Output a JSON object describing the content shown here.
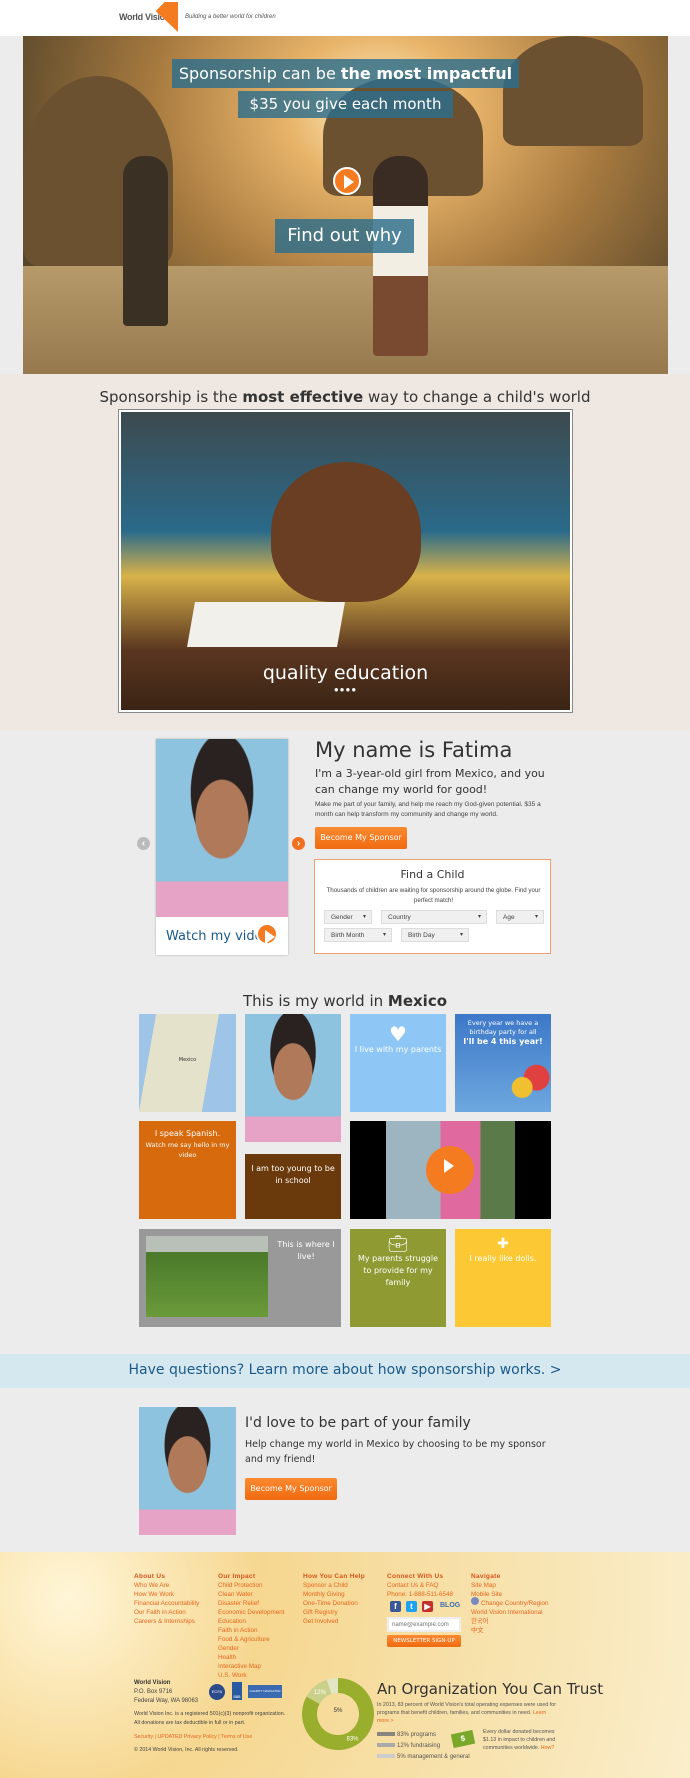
{
  "header": {
    "logo_text": "World Vision",
    "tagline": "Building a better world for children"
  },
  "hero": {
    "headline_prefix": "Sponsorship can be ",
    "headline_bold": "the most impactful",
    "subline": "$35 you give each month",
    "cta": "Find out why"
  },
  "impact": {
    "title_prefix": "Sponsorship is the ",
    "title_bold": "most effective",
    "title_suffix": " way to change a child's world",
    "caption": "quality education",
    "dots": "●●●●"
  },
  "child": {
    "name_heading": "My name is Fatima",
    "intro": "I'm a 3-year-old girl from Mexico, and you can change my world for good!",
    "details": "Make me part of your family, and help me reach my God-given potential. $35 a month can help transform my community and change my world.",
    "sponsor_button": "Become My Sponsor",
    "watch_video": "Watch my video!",
    "prev_arrow": "‹",
    "next_arrow": "›"
  },
  "find_child": {
    "title": "Find a Child",
    "description": "Thousands of children are waiting for sponsorship around the globe. Find your perfect match!",
    "filters": {
      "gender": "Gender",
      "country": "Country",
      "age": "Age",
      "birth_month": "Birth Month",
      "birth_day": "Birth Day"
    }
  },
  "world": {
    "title_prefix": "This is my world in ",
    "title_bold": "Mexico",
    "map_label": "Mexico",
    "parents": "I live with my parents",
    "birthday_line1": "Every year we have a",
    "birthday_line2": "birthday party for all",
    "birthday_line3": "I'll be 4 this year!",
    "spanish_title": "I speak Spanish.",
    "spanish_sub": "Watch me say hello in my video",
    "school": "I am too young to be in school",
    "where_live": "This is where I live!",
    "struggle": "My parents struggle to provide for my family",
    "dolls": "I really like dolls.",
    "colors": {
      "map": "#d7e3c8",
      "parents": "#8ec7f5",
      "spanish": "#d66a0c",
      "school": "#6b3a0c",
      "where": "#999999",
      "struggle": "#8f9a32",
      "dolls": "#fcc934"
    }
  },
  "questions": {
    "text": "Have questions? Learn more about how sponsorship works. >"
  },
  "family": {
    "title": "I'd love to be part of your family",
    "text": "Help change my world in Mexico by choosing to be my sponsor and my friend!",
    "button": "Become My Sponsor"
  },
  "footer": {
    "columns": [
      {
        "heading": "About Us",
        "links": [
          "Who We Are",
          "How We Work",
          "Financial Accountability",
          "Our Faith in Action",
          "Careers & Internships"
        ]
      },
      {
        "heading": "Our Impact",
        "links": [
          "Child Protection",
          "Clean Water",
          "Disaster Relief",
          "Economic Development",
          "Education",
          "Faith in Action",
          "Food & Agriculture",
          "Gender",
          "Health",
          "Interactive Map",
          "U.S. Work"
        ]
      },
      {
        "heading": "How You Can Help",
        "links": [
          "Sponsor a Child",
          "Monthly Giving",
          "One-Time Donation",
          "Gift Registry",
          "Get Involved"
        ]
      },
      {
        "heading": "Connect With Us",
        "links": [
          "Contact Us & FAQ",
          "Phone: 1-888-511-6548"
        ]
      },
      {
        "heading": "Navigate",
        "links": [
          "Site Map",
          "Mobile Site",
          "Change Country/Region",
          "World Vision International",
          "한국어",
          "中文"
        ]
      }
    ],
    "blog": "BLOG",
    "email_placeholder": "name@example.com",
    "newsletter_button": "NEWSLETTER SIGN-UP",
    "org_name": "World Vision",
    "address1": "P.O. Box 9716",
    "address2": "Federal Way, WA 98063",
    "badges": [
      "ECFA",
      "BBB",
      "CHARITY NAVIGATOR"
    ],
    "legal1": "World Vision Inc. is a registered 501(c)(3) nonprofit organization.",
    "legal2": "All donations are tax deductible in full or in part.",
    "legal_links": [
      "Security",
      "UPDATED Privacy Policy",
      "Terms of Use"
    ],
    "copyright": "© 2014 World Vision, Inc. All rights reserved."
  },
  "trust": {
    "title": "An Organization You Can Trust",
    "text": "In 2013, 83 percent of World Vision's total operating expenses were used for programs that benefit children, families, and communities in need.",
    "learn_more": "Learn more >",
    "dollar_text": "Every dollar donated becomes $1.13 in impact to children and communities worldwide.",
    "how": "How?",
    "chart_data": {
      "type": "pie",
      "categories": [
        "programs",
        "fundraising",
        "management & general"
      ],
      "values": [
        83,
        12,
        5
      ],
      "labels": [
        "83%",
        "12%",
        "5%"
      ],
      "legend": [
        "83% programs",
        "12% fundraising",
        "5% management & general"
      ],
      "colors": [
        "#9aae2e",
        "#c9d08a",
        "#e3e6c4"
      ]
    }
  }
}
